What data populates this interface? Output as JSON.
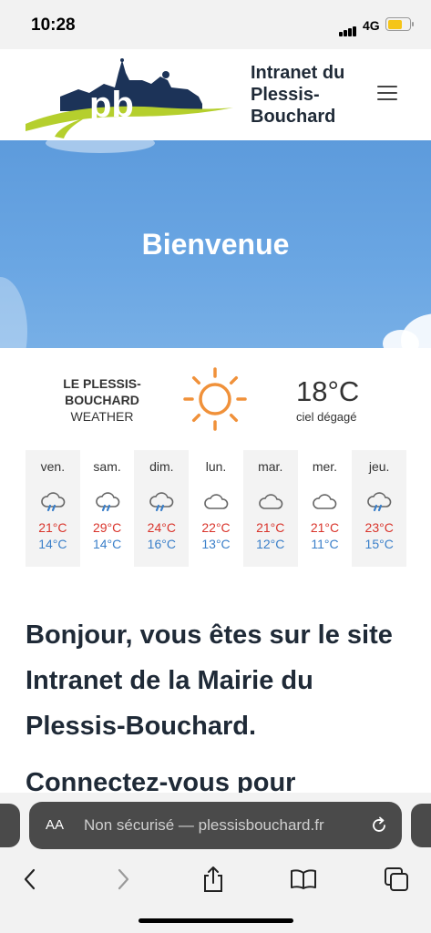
{
  "status_bar": {
    "time": "10:28",
    "network": "4G"
  },
  "header": {
    "title": "Intranet du Plessis-Bouchard",
    "logo_text": "pb"
  },
  "hero": {
    "title": "Bienvenue"
  },
  "weather": {
    "location_line1": "LE PLESSIS-",
    "location_line2": "BOUCHARD",
    "label": "WEATHER",
    "temperature": "18°C",
    "description": "ciel dégagé",
    "current_icon": "sun-icon",
    "forecast": [
      {
        "day": "ven.",
        "icon": "rain-cloud-icon",
        "high": "21°C",
        "low": "14°C"
      },
      {
        "day": "sam.",
        "icon": "rain-cloud-icon",
        "high": "29°C",
        "low": "14°C"
      },
      {
        "day": "dim.",
        "icon": "rain-cloud-icon",
        "high": "24°C",
        "low": "16°C"
      },
      {
        "day": "lun.",
        "icon": "cloud-icon",
        "high": "22°C",
        "low": "13°C"
      },
      {
        "day": "mar.",
        "icon": "cloud-icon",
        "high": "21°C",
        "low": "12°C"
      },
      {
        "day": "mer.",
        "icon": "cloud-icon",
        "high": "21°C",
        "low": "11°C"
      },
      {
        "day": "jeu.",
        "icon": "rain-cloud-icon",
        "high": "23°C",
        "low": "15°C"
      }
    ]
  },
  "content": {
    "intro": "Bonjour, vous êtes sur le site Intranet de la Mairie du Plessis-Bouchard.",
    "connect": "Connectez-vous pour"
  },
  "browser": {
    "aa_label": "AA",
    "url_text": "Non sécurisé — plessisbouchard.fr"
  },
  "colors": {
    "hero_blue": "#6aa6e3",
    "temp_high": "#d9342b",
    "temp_low": "#3a7fc9",
    "logo_navy": "#1c3358",
    "logo_green": "#b5cf2d",
    "sun_orange": "#f0913a"
  }
}
